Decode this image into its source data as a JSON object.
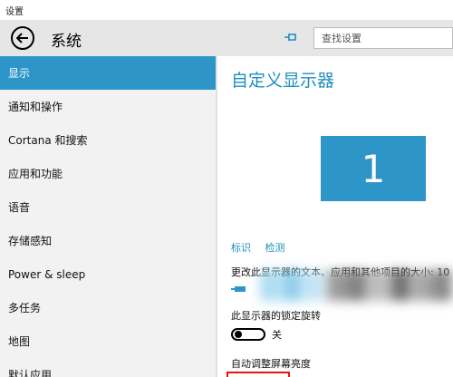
{
  "window": {
    "title": "设置"
  },
  "header": {
    "section_title": "系统",
    "search_placeholder": "查找设置"
  },
  "sidebar": {
    "items": [
      {
        "label": "显示",
        "active": true
      },
      {
        "label": "通知和操作",
        "active": false
      },
      {
        "label": "Cortana 和搜索",
        "active": false
      },
      {
        "label": "应用和功能",
        "active": false
      },
      {
        "label": "语音",
        "active": false
      },
      {
        "label": "存储感知",
        "active": false
      },
      {
        "label": "Power & sleep",
        "active": false
      },
      {
        "label": "多任务",
        "active": false
      },
      {
        "label": "地图",
        "active": false
      },
      {
        "label": "默认应用",
        "active": false
      }
    ]
  },
  "main": {
    "title": "自定义显示器",
    "monitor_number": "1",
    "identify_link": "标识",
    "detect_link": "检测",
    "scale_label": "更改此显示器的文本、应用和其他项目的大小: 10",
    "rotation_lock_label": "此显示器的锁定旋转",
    "rotation_lock_state": "关",
    "auto_brightness_label": "自动调整屏幕亮度"
  },
  "colors": {
    "accent": "#2d95c8",
    "accent_text": "#1f8fbf",
    "sidebar_bg": "#f2f2f2",
    "header_bg": "#e6e6e6",
    "highlight_box": "#e11111"
  }
}
